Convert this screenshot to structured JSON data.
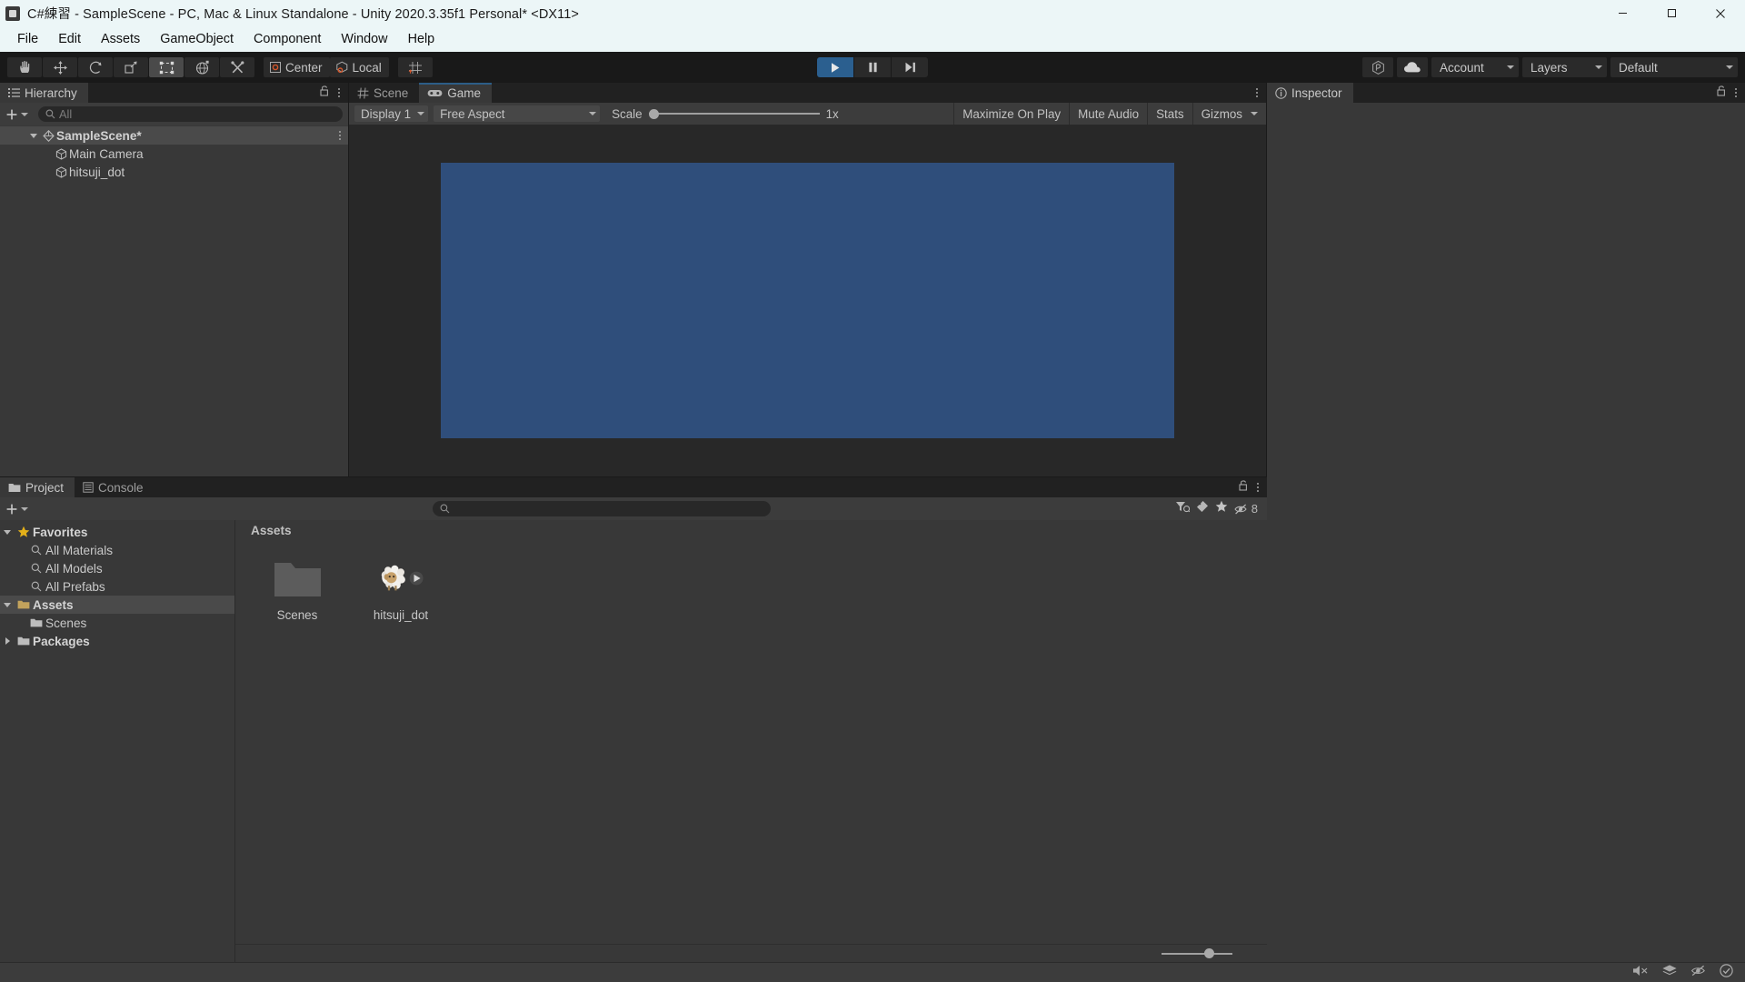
{
  "window": {
    "title": "C#練習 - SampleScene - PC, Mac & Linux Standalone - Unity 2020.3.35f1 Personal* <DX11>",
    "app_icon": "unity-icon",
    "minimize_label": "minimize-icon",
    "maximize_label": "maximize-icon",
    "close_label": "close-icon"
  },
  "menubar": {
    "items": [
      {
        "label": "File"
      },
      {
        "label": "Edit"
      },
      {
        "label": "Assets"
      },
      {
        "label": "GameObject"
      },
      {
        "label": "Component"
      },
      {
        "label": "Window"
      },
      {
        "label": "Help"
      }
    ]
  },
  "toolbar": {
    "tools": [
      {
        "name": "hand-tool",
        "icon": "hand-icon",
        "active": false
      },
      {
        "name": "move-tool",
        "icon": "move-arrows-icon",
        "active": false
      },
      {
        "name": "rotate-tool",
        "icon": "rotate-icon",
        "active": false
      },
      {
        "name": "scale-tool",
        "icon": "scale-icon",
        "active": false
      },
      {
        "name": "rect-tool",
        "icon": "rect-transform-icon",
        "active": true
      },
      {
        "name": "transform-tool",
        "icon": "transform-globe-icon",
        "active": false
      },
      {
        "name": "custom-tool",
        "icon": "wrench-screwdriver-icon",
        "active": false
      }
    ],
    "pivot": {
      "label": "Center",
      "icon": "pivot-center-icon"
    },
    "handle": {
      "label": "Local",
      "icon": "handle-local-icon"
    },
    "snap": {
      "name": "grid-snap-button",
      "icon": "grid-snap-icon"
    },
    "play": {
      "label": "play-icon",
      "state": "playing"
    },
    "pause": {
      "label": "pause-icon"
    },
    "step": {
      "label": "step-icon"
    },
    "collab": {
      "label": "collab-icon"
    },
    "cloud": {
      "label": "cloud-icon"
    },
    "account": {
      "label": "Account"
    },
    "layers": {
      "label": "Layers"
    },
    "layout": {
      "label": "Default"
    }
  },
  "hierarchy": {
    "tab": {
      "label": "Hierarchy",
      "icon": "hierarchy-icon"
    },
    "lock_icon": "lock-open-icon",
    "menu_icon": "kebab-menu-icon",
    "add_label": "+",
    "search_placeholder": "All",
    "search_icon": "search-icon",
    "search_value": "",
    "rows": [
      {
        "label": "SampleScene*",
        "depth": 0,
        "icon": "unity-scene-icon",
        "expanded": true,
        "selected": true,
        "bold": true,
        "more": "⋮"
      },
      {
        "label": "Main Camera",
        "depth": 1,
        "icon": "gameobject-cube-icon",
        "expanded": null,
        "selected": false,
        "bold": false
      },
      {
        "label": "hitsuji_dot",
        "depth": 1,
        "icon": "gameobject-cube-icon",
        "expanded": null,
        "selected": false,
        "bold": false
      }
    ]
  },
  "view_panel": {
    "tabs": [
      {
        "label": "Scene",
        "icon": "scene-grid-icon",
        "active": false
      },
      {
        "label": "Game",
        "icon": "game-controller-icon",
        "active": true
      }
    ],
    "menu_icon": "kebab-menu-icon",
    "display": {
      "label": "Display 1"
    },
    "aspect": {
      "label": "Free Aspect"
    },
    "scale": {
      "label": "Scale",
      "value": "1x",
      "slider_pct": 0
    },
    "maximize_on_play": "Maximize On Play",
    "mute_audio": "Mute Audio",
    "stats": "Stats",
    "gizmos": "Gizmos",
    "game_bg_color": "#2f4e7b"
  },
  "project": {
    "tabs": [
      {
        "label": "Project",
        "icon": "folder-icon",
        "active": true
      },
      {
        "label": "Console",
        "icon": "console-icon",
        "active": false
      }
    ],
    "lock_icon": "lock-open-icon",
    "menu_icon": "kebab-menu-icon",
    "add_label": "+",
    "search_placeholder": "",
    "search_icon": "search-icon",
    "search_value": "",
    "filter_icons": [
      "filter-by-type-icon",
      "filter-by-label-icon",
      "favorite-star-icon",
      "hidden-packages-icon"
    ],
    "hidden_packages_count": "8",
    "tree": [
      {
        "label": "Favorites",
        "depth": 0,
        "icon": "favorite-star-icon",
        "expanded": true,
        "bold": true,
        "selected": false
      },
      {
        "label": "All Materials",
        "depth": 1,
        "icon": "search-icon",
        "expanded": null,
        "bold": false,
        "selected": false
      },
      {
        "label": "All Models",
        "depth": 1,
        "icon": "search-icon",
        "expanded": null,
        "bold": false,
        "selected": false
      },
      {
        "label": "All Prefabs",
        "depth": 1,
        "icon": "search-icon",
        "expanded": null,
        "bold": false,
        "selected": false
      },
      {
        "label": "Assets",
        "depth": 0,
        "icon": "folder-open-icon",
        "expanded": true,
        "bold": true,
        "selected": true
      },
      {
        "label": "Scenes",
        "depth": 1,
        "icon": "folder-icon",
        "expanded": null,
        "bold": false,
        "selected": false
      },
      {
        "label": "Packages",
        "depth": 0,
        "icon": "folder-icon",
        "expanded": false,
        "bold": true,
        "selected": false
      }
    ],
    "breadcrumb": "Assets",
    "assets": [
      {
        "name": "Scenes",
        "kind": "folder",
        "icon": "folder-large-icon",
        "has_preview_badge": false
      },
      {
        "name": "hitsuji_dot",
        "kind": "sprite",
        "icon": "sheep-sprite-icon",
        "has_preview_badge": true
      }
    ],
    "zoom_slider_pct": 60
  },
  "inspector": {
    "tab": {
      "label": "Inspector",
      "icon": "info-circle-icon"
    },
    "lock_icon": "lock-open-icon",
    "menu_icon": "kebab-menu-icon",
    "content": ""
  },
  "statusbar": {
    "icons": [
      "mute-audio-status-icon",
      "layers-status-icon",
      "visibility-off-status-icon",
      "check-circle-status-icon"
    ]
  }
}
